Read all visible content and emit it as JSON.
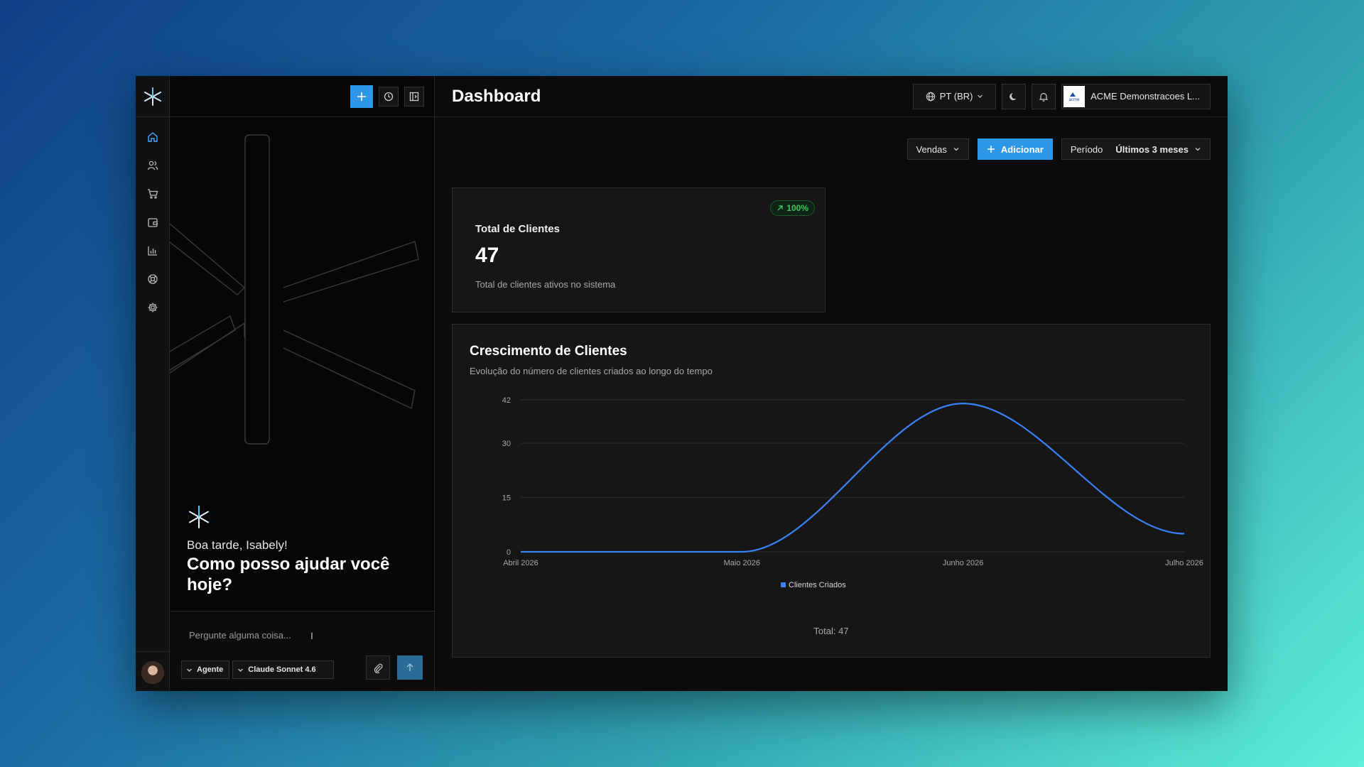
{
  "chat": {
    "greeting": "Boa tarde, Isabely!",
    "prompt_heading": "Como posso ajudar você hoje?",
    "input_placeholder": "Pergunte alguma coisa...",
    "mode_label": "Agente",
    "model_label": "Claude Sonnet 4.6"
  },
  "rail": {
    "items": [
      "home-icon",
      "users-icon",
      "cart-icon",
      "wallet-icon",
      "bar-chart-icon",
      "support-icon",
      "settings-icon"
    ]
  },
  "header": {
    "title": "Dashboard",
    "language": "PT (BR)",
    "org_name": "ACME Demonstracoes L...",
    "org_logo_text": "acme"
  },
  "toolbar": {
    "view_select": "Vendas",
    "add_label": "Adicionar",
    "period_label": "Período",
    "period_value": "Últimos 3 meses"
  },
  "kpi": {
    "badge": "100%",
    "label": "Total de Clientes",
    "value": "47",
    "description": "Total de clientes ativos no sistema"
  },
  "chart": {
    "title": "Crescimento de Clientes",
    "subtitle": "Evolução do número de clientes criados ao longo do tempo",
    "total": "Total: 47",
    "line_color": "#3b82f6"
  },
  "chart_data": {
    "type": "line",
    "title": "Crescimento de Clientes",
    "subtitle": "Evolução do número de clientes criados ao longo do tempo",
    "categories": [
      "Abril 2026",
      "Maio 2026",
      "Junho 2026",
      "Julho 2026"
    ],
    "series": [
      {
        "name": "Clientes Criados",
        "values": [
          0,
          0,
          41,
          5
        ]
      }
    ],
    "yticks": [
      0,
      15,
      30,
      42
    ],
    "ylim": [
      0,
      42
    ],
    "grid": true,
    "legend": "bottom-center",
    "xlabel": "",
    "ylabel": ""
  },
  "colors": {
    "accent": "#2f97e8",
    "badge_green": "#43c35f"
  }
}
